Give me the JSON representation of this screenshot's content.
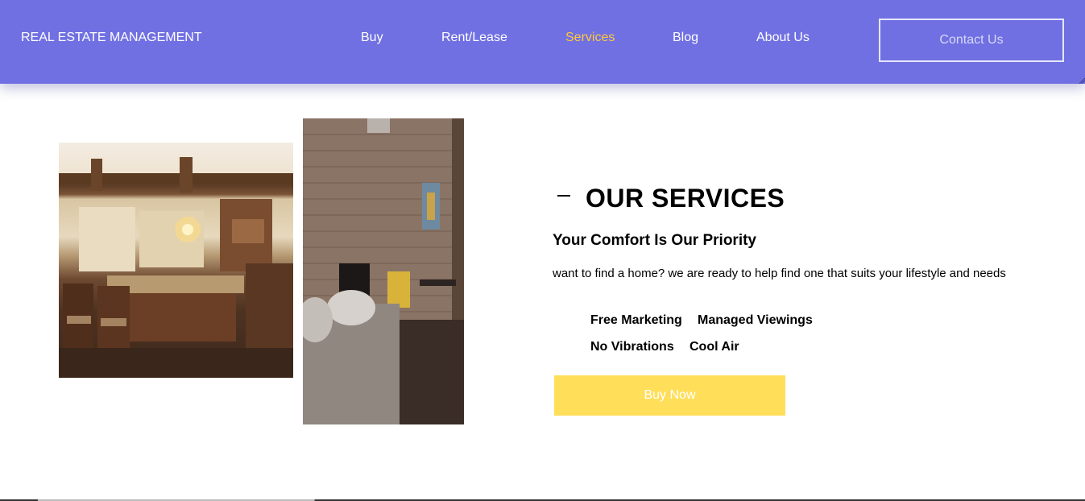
{
  "header": {
    "brand": "REAL ESTATE MANAGEMENT",
    "nav": [
      {
        "label": "Buy"
      },
      {
        "label": "Rent/Lease"
      },
      {
        "label": "Services",
        "active": true
      },
      {
        "label": "Blog"
      },
      {
        "label": "About Us"
      }
    ],
    "contact_label": "Contact Us"
  },
  "services": {
    "title": "OUR SERVICES",
    "subtitle": "Your Comfort Is Our Priority",
    "description": "want to find a home? we are ready to help find one that suits your lifestyle and needs",
    "features": [
      "Free Marketing",
      "Managed Viewings",
      "No Vibrations",
      "Cool Air"
    ],
    "buy_label": "Buy Now"
  },
  "colors": {
    "nav_background": "#7070e3",
    "active_link": "#ffc93c",
    "buy_button": "#ffdf5a"
  }
}
